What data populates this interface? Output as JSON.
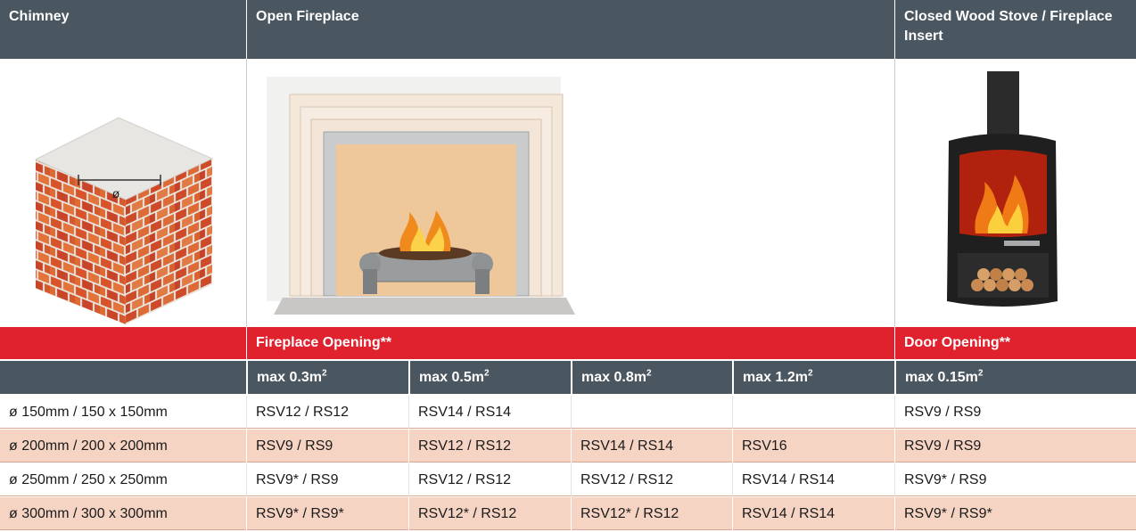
{
  "headers": {
    "chimney": "Chimney",
    "open_fireplace": "Open Fireplace",
    "closed_stove": "Closed Wood Stove / Fireplace Insert"
  },
  "images": {
    "chimney_diameter_symbol": "ø"
  },
  "red_row": {
    "fireplace_opening": "Fireplace Opening**",
    "door_opening": "Door Opening**"
  },
  "size_row": {
    "col1": "max 0.3m",
    "col2": "max 0.5m",
    "col3": "max 0.8m",
    "col4": "max 1.2m",
    "col5": "max 0.15m",
    "exp": "2"
  },
  "rows": [
    {
      "chimney": "ø 150mm / 150 x 150mm",
      "c1": "RSV12 / RS12",
      "c2": "RSV14 / RS14",
      "c3": "",
      "c4": "",
      "c5": "RSV9 / RS9"
    },
    {
      "chimney": "ø 200mm / 200 x 200mm",
      "c1": "RSV9 / RS9",
      "c2": "RSV12 / RS12",
      "c3": "RSV14 / RS14",
      "c4": "RSV16",
      "c5": "RSV9 / RS9"
    },
    {
      "chimney": "ø 250mm / 250 x 250mm",
      "c1": "RSV9* / RS9",
      "c2": "RSV12 / RS12",
      "c3": "RSV12 / RS12",
      "c4": "RSV14 / RS14",
      "c5": "RSV9* / RS9"
    },
    {
      "chimney": "ø 300mm / 300 x 300mm",
      "c1": "RSV9* / RS9*",
      "c2": "RSV12* / RS12",
      "c3": "RSV12* / RS12",
      "c4": "RSV14 / RS14",
      "c5": "RSV9* / RS9*"
    }
  ],
  "colors": {
    "header_gray": "#4a5660",
    "accent_red": "#e0212e",
    "row_alt_peach": "#f6d4c4"
  }
}
